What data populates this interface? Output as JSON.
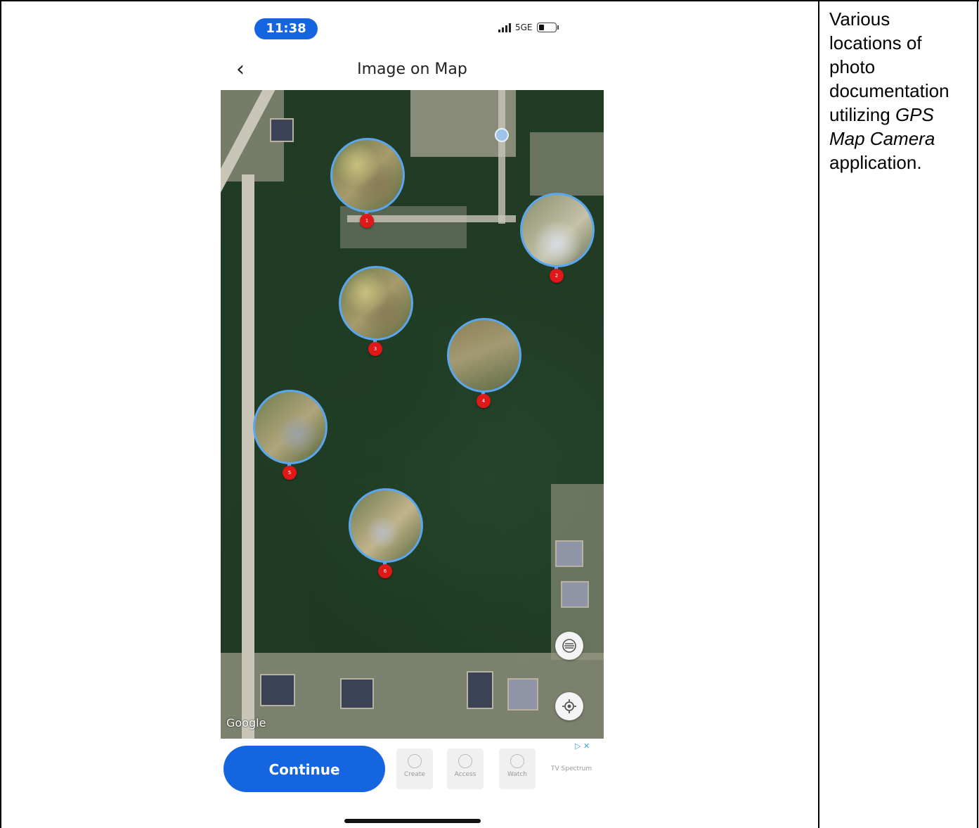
{
  "caption": {
    "line1": "Various",
    "line2": "locations of",
    "line3": "photo",
    "line4": "documentation",
    "line5_prefix": "utilizing ",
    "line5_em": "GPS",
    "line6_em": "Map Camera",
    "line7": "application."
  },
  "phone": {
    "status": {
      "time": "11:38",
      "network": "5GE",
      "battery_icon": "battery-low-icon",
      "signal_icon": "cellular-signal-icon"
    },
    "nav": {
      "back_icon": "chevron-left-icon",
      "back_glyph": "‹",
      "title": "Image on Map"
    },
    "map": {
      "markers": [
        {
          "label": "1"
        },
        {
          "label": "2"
        },
        {
          "label": "3"
        },
        {
          "label": "4"
        },
        {
          "label": "5"
        },
        {
          "label": "6"
        }
      ],
      "layers_icon": "layers-icon",
      "locate_icon": "my-location-icon",
      "attribution": "Google"
    },
    "bottom": {
      "continue_label": "Continue",
      "ad_tiles": [
        {
          "label": "Create"
        },
        {
          "label": "Access"
        },
        {
          "label": "Watch"
        }
      ],
      "ad_text": "TV Spectrum",
      "ad_badge": "▷ ✕"
    },
    "accent_color": "#1565e0",
    "marker_border_color": "#5aa7ee",
    "pin_color": "#e01818"
  }
}
